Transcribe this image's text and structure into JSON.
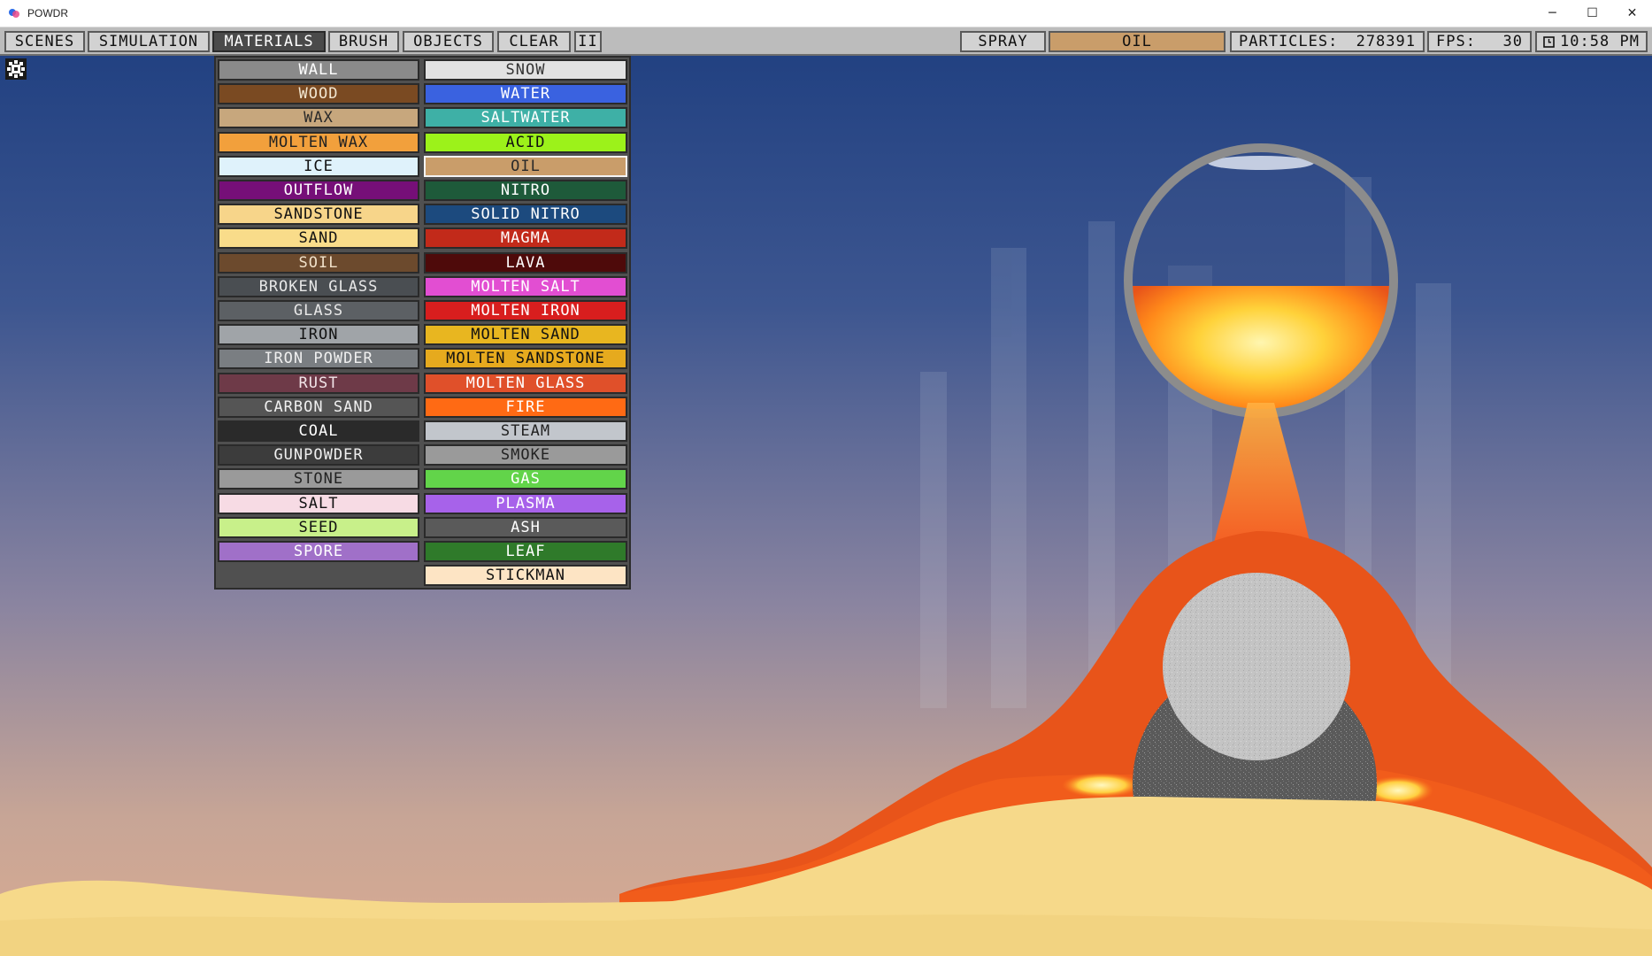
{
  "window": {
    "title": "POWDR",
    "controls": [
      "─",
      "☐",
      "✕"
    ]
  },
  "menu": {
    "scenes": "SCENES",
    "simulation": "SIMULATION",
    "materials": "MATERIALS",
    "brush": "BRUSH",
    "objects": "OBJECTS",
    "clear": "CLEAR",
    "pause": "II"
  },
  "status": {
    "tool": "SPRAY",
    "material": "OIL",
    "particles_label": "PARTICLES:",
    "particles_value": "278391",
    "fps_label": "FPS:",
    "fps_value": "30",
    "clock_icon": "clock-icon",
    "time": "10:58 PM"
  },
  "materials_left": [
    {
      "label": "WALL",
      "bg": "#8a8a8a",
      "fg": "#ffffff"
    },
    {
      "label": "WOOD",
      "bg": "#7a4a22",
      "fg": "#f2e6d0"
    },
    {
      "label": "WAX",
      "bg": "#c7a77d",
      "fg": "#2a2a2a"
    },
    {
      "label": "MOLTEN WAX",
      "bg": "#f2a03c",
      "fg": "#222222"
    },
    {
      "label": "ICE",
      "bg": "#dff2fb",
      "fg": "#111111"
    },
    {
      "label": "OUTFLOW",
      "bg": "#760f78",
      "fg": "#ffffff"
    },
    {
      "label": "SANDSTONE",
      "bg": "#f7d58a",
      "fg": "#111111"
    },
    {
      "label": "SAND",
      "bg": "#f9dc8a",
      "fg": "#111111"
    },
    {
      "label": "SOIL",
      "bg": "#6c4a2d",
      "fg": "#f0e0c8"
    },
    {
      "label": "BROKEN GLASS",
      "bg": "#4a4e52",
      "fg": "#e8e8e8"
    },
    {
      "label": "GLASS",
      "bg": "#5c6064",
      "fg": "#e8e8e8"
    },
    {
      "label": "IRON",
      "bg": "#a0a4a8",
      "fg": "#111111"
    },
    {
      "label": "IRON POWDER",
      "bg": "#7a7e82",
      "fg": "#f0f0f0"
    },
    {
      "label": "RUST",
      "bg": "#6e3a48",
      "fg": "#f2e4e8"
    },
    {
      "label": "CARBON SAND",
      "bg": "#555555",
      "fg": "#f0f0f0"
    },
    {
      "label": "COAL",
      "bg": "#2a2a2a",
      "fg": "#ffffff"
    },
    {
      "label": "GUNPOWDER",
      "bg": "#3c3c3c",
      "fg": "#f0f0f0"
    },
    {
      "label": "STONE",
      "bg": "#9a9a9a",
      "fg": "#222222"
    },
    {
      "label": "SALT",
      "bg": "#f7dbe4",
      "fg": "#111111"
    },
    {
      "label": "SEED",
      "bg": "#c8f08a",
      "fg": "#111111"
    },
    {
      "label": "SPORE",
      "bg": "#a070c8",
      "fg": "#ffffff"
    }
  ],
  "materials_right": [
    {
      "label": "SNOW",
      "bg": "#e2e2e2",
      "fg": "#333333"
    },
    {
      "label": "WATER",
      "bg": "#3a62e0",
      "fg": "#ffffff"
    },
    {
      "label": "SALTWATER",
      "bg": "#3eb0a6",
      "fg": "#ffffff"
    },
    {
      "label": "ACID",
      "bg": "#9cf21a",
      "fg": "#111111"
    },
    {
      "label": "OIL",
      "bg": "#c99d6a",
      "fg": "#2a2a2a"
    },
    {
      "label": "NITRO",
      "bg": "#1e5a3a",
      "fg": "#ffffff"
    },
    {
      "label": "SOLID NITRO",
      "bg": "#1c4a7e",
      "fg": "#ffffff"
    },
    {
      "label": "MAGMA",
      "bg": "#c22a1a",
      "fg": "#ffffff"
    },
    {
      "label": "LAVA",
      "bg": "#4e0a0a",
      "fg": "#ffffff"
    },
    {
      "label": "MOLTEN SALT",
      "bg": "#e24ed2",
      "fg": "#ffffff"
    },
    {
      "label": "MOLTEN IRON",
      "bg": "#d81e1e",
      "fg": "#ffffff"
    },
    {
      "label": "MOLTEN SAND",
      "bg": "#e8b620",
      "fg": "#111111"
    },
    {
      "label": "MOLTEN SANDSTONE",
      "bg": "#e6aa1e",
      "fg": "#111111"
    },
    {
      "label": "MOLTEN GLASS",
      "bg": "#e0502a",
      "fg": "#ffffff"
    },
    {
      "label": "FIRE",
      "bg": "#ff6a14",
      "fg": "#ffffff"
    },
    {
      "label": "STEAM",
      "bg": "#c2c6cc",
      "fg": "#222222"
    },
    {
      "label": "SMOKE",
      "bg": "#9a9a9a",
      "fg": "#222222"
    },
    {
      "label": "GAS",
      "bg": "#62d44a",
      "fg": "#ffffff"
    },
    {
      "label": "PLASMA",
      "bg": "#a762ea",
      "fg": "#ffffff"
    },
    {
      "label": "ASH",
      "bg": "#5a5a5a",
      "fg": "#ffffff"
    },
    {
      "label": "LEAF",
      "bg": "#2f7a2a",
      "fg": "#ffffff"
    },
    {
      "label": "STICKMAN",
      "bg": "#fde4c4",
      "fg": "#111111"
    }
  ]
}
